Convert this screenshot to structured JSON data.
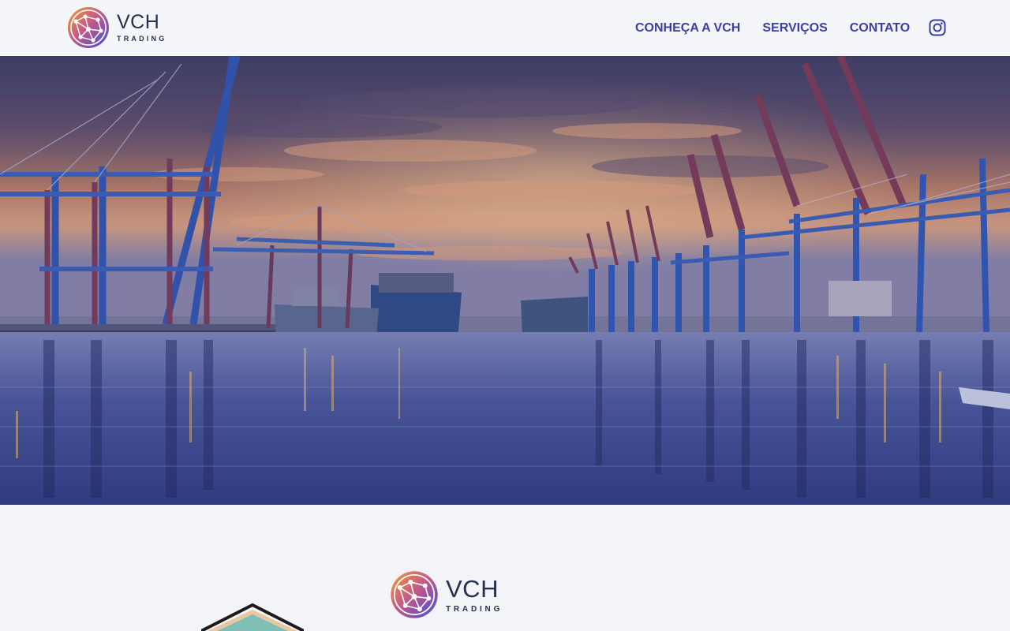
{
  "header": {
    "logo": {
      "name": "VCH",
      "tagline": "TRADING",
      "icon": "globe-network-icon"
    },
    "nav": [
      {
        "label": "CONHEÇA A VCH"
      },
      {
        "label": "SERVIÇOS"
      },
      {
        "label": "CONTATO"
      }
    ],
    "social_icon": "instagram-icon"
  },
  "hero": {
    "image": "container-port-sunset-photo"
  },
  "about": {
    "logo": {
      "name": "VCH",
      "tagline": "TRADING"
    },
    "illustration": "house-illustration"
  },
  "colors": {
    "nav_text": "#3b3fa4",
    "logo_text": "#27304f",
    "logo_gradient_start": "#f08a2c",
    "logo_gradient_end": "#3d5bd6",
    "page_background": "#f3f4f7"
  }
}
